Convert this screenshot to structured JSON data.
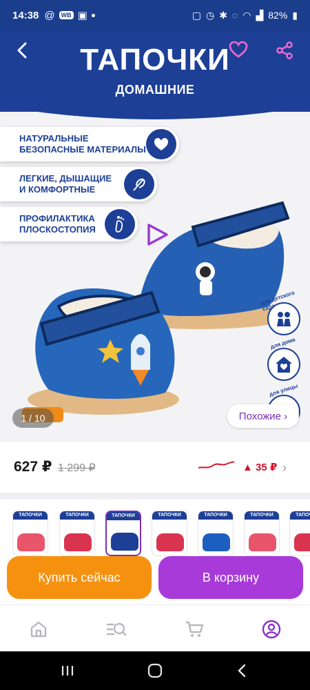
{
  "status_bar": {
    "time": "14:38",
    "app_chip": "WB",
    "battery": "82%"
  },
  "product_image": {
    "brand_title": "ТАПОЧКИ",
    "brand_subtitle": "ДОМАШНИЕ",
    "features": [
      {
        "label": "НАТУРАЛЬНЫЕ\nБЕЗОПАСНЫЕ МАТЕРИАЛЫ",
        "icon": "heart-icon"
      },
      {
        "label": "ЛЕГКИЕ, ДЫШАЩИЕ\nИ КОМФОРТНЫЕ",
        "icon": "feather-icon"
      },
      {
        "label": "ПРОФИЛАКТИКА\nПЛОСКОСТОПИЯ",
        "icon": "footprint-icon"
      }
    ],
    "side_badges": [
      {
        "label": "для детского сада",
        "icon": "kids-icon"
      },
      {
        "label": "для дома",
        "icon": "house-heart-icon"
      },
      {
        "label": "для улицы",
        "icon": "street-icon"
      }
    ],
    "counter": "1 / 10",
    "similar_label": "Похожие ›"
  },
  "price": {
    "current": "627 ₽",
    "old": "1 299 ₽",
    "delta": "▲ 35 ₽"
  },
  "thumbnails": {
    "title_text": "ТАПОЧКИ",
    "items": [
      {
        "color": "#e8556a"
      },
      {
        "color": "#d8344f"
      },
      {
        "color": "#1d3f96",
        "active": true
      },
      {
        "color": "#d8344f"
      },
      {
        "color": "#1d5fc0"
      },
      {
        "color": "#e8556a"
      },
      {
        "color": "#d8344f"
      }
    ]
  },
  "actions": {
    "buy_now": "Купить сейчас",
    "add_to_cart": "В корзину"
  },
  "colors": {
    "brand_blue": "#1d3f96",
    "buy_orange": "#f6910f",
    "cart_purple": "#a73ad9",
    "price_red": "#d0142c"
  }
}
